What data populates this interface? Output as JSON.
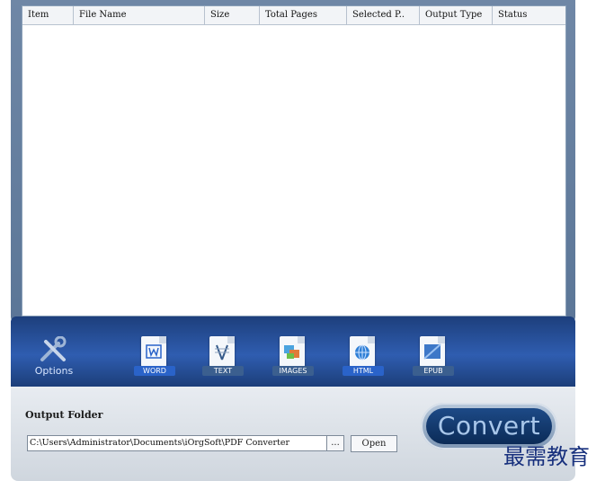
{
  "table": {
    "columns": [
      {
        "label": "Item"
      },
      {
        "label": "File Name"
      },
      {
        "label": "Size"
      },
      {
        "label": "Total Pages"
      },
      {
        "label": "Selected P.."
      },
      {
        "label": "Output Type"
      },
      {
        "label": "Status"
      }
    ]
  },
  "toolbar": {
    "options_label": "Options",
    "formats": [
      {
        "label": "WORD",
        "icon": "word-document-icon",
        "color": "#2a63c9"
      },
      {
        "label": "TEXT",
        "icon": "text-document-icon",
        "color": "#3b5f8f"
      },
      {
        "label": "IMAGES",
        "icon": "images-document-icon",
        "color": "#3b5f8f"
      },
      {
        "label": "HTML",
        "icon": "html-globe-icon",
        "color": "#2a63c9"
      },
      {
        "label": "EPUB",
        "icon": "epub-document-icon",
        "color": "#3b5f8f"
      }
    ]
  },
  "output": {
    "label": "Output Folder",
    "path": "C:\\Users\\Administrator\\Documents\\iOrgSoft\\PDF Converter",
    "browse_label": "...",
    "open_label": "Open"
  },
  "convert_label": "Convert",
  "watermark": "最需教育"
}
